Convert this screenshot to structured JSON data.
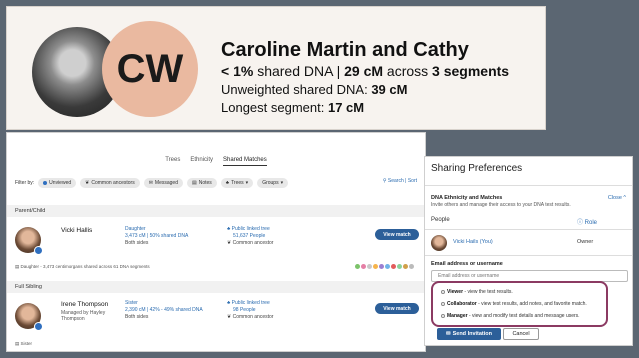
{
  "hero": {
    "initials": "CW",
    "name": "Caroline Martin and Cathy",
    "shared_prefix": "< 1%",
    "shared_mid": " shared DNA | ",
    "shared_cm": "29 cM",
    "shared_across": " across ",
    "shared_segments": "3 segments",
    "unweighted_label": "Unweighted shared DNA: ",
    "unweighted_value": "39 cM",
    "longest_label": "Longest segment: ",
    "longest_value": "17 cM"
  },
  "matches": {
    "tabs": [
      "Trees",
      "Ethnicity",
      "Shared Matches"
    ],
    "active_tab": 2,
    "filter_label": "Filter by:",
    "chips": [
      "Unviewed",
      "Common ancestors",
      "Messaged",
      "Notes",
      "Trees",
      "Groups"
    ],
    "search_sort": "Search | Sort",
    "sections": [
      {
        "title": "Parent/Child",
        "name": "Vicki Hallis",
        "managed": "",
        "relation": "Daughter",
        "dna": "3,473 cM | 50% shared DNA",
        "sides": "Both sides",
        "tree": "Public linked tree",
        "people": "51,637 People",
        "common": "Common ancestor",
        "view": "View match",
        "footnote": "Daughter - 3,473 centimorgans shared across 61 DNA segments"
      },
      {
        "title": "Full Sibling",
        "name": "Irene Thompson",
        "managed": "Managed by Hayley Thompson",
        "relation": "Sister",
        "dna": "2,390 cM | 42% - 49% shared DNA",
        "sides": "Both sides",
        "tree": "Public linked tree",
        "people": "98 People",
        "common": "Common ancestor",
        "view": "View match",
        "footnote": "Sister"
      }
    ],
    "dot_colors": [
      "#7cc36a",
      "#e57fa6",
      "#c8c8c8",
      "#f6b44c",
      "#9b7fd1",
      "#6fb4e8",
      "#e25c5c",
      "#8bd19a",
      "#d0a04a",
      "#bbb"
    ]
  },
  "share": {
    "title": "Sharing Preferences",
    "section_head": "DNA Ethnicity and Matches",
    "section_desc": "Invite others and manage their access to your DNA test results.",
    "close": "Close",
    "people_label": "People",
    "role_label": "Role",
    "person_name": "Vicki Hails (You)",
    "person_role": "Owner",
    "email_label": "Email address or username",
    "email_placeholder": "Email address or username",
    "roles": [
      {
        "name": "Viewer",
        "desc": " - view the test results."
      },
      {
        "name": "Collaborator",
        "desc": " - view test results, add notes, and favorite match."
      },
      {
        "name": "Manager",
        "desc": " - view and modify test details and message users."
      }
    ],
    "send": "Send Invitation",
    "cancel": "Cancel"
  }
}
